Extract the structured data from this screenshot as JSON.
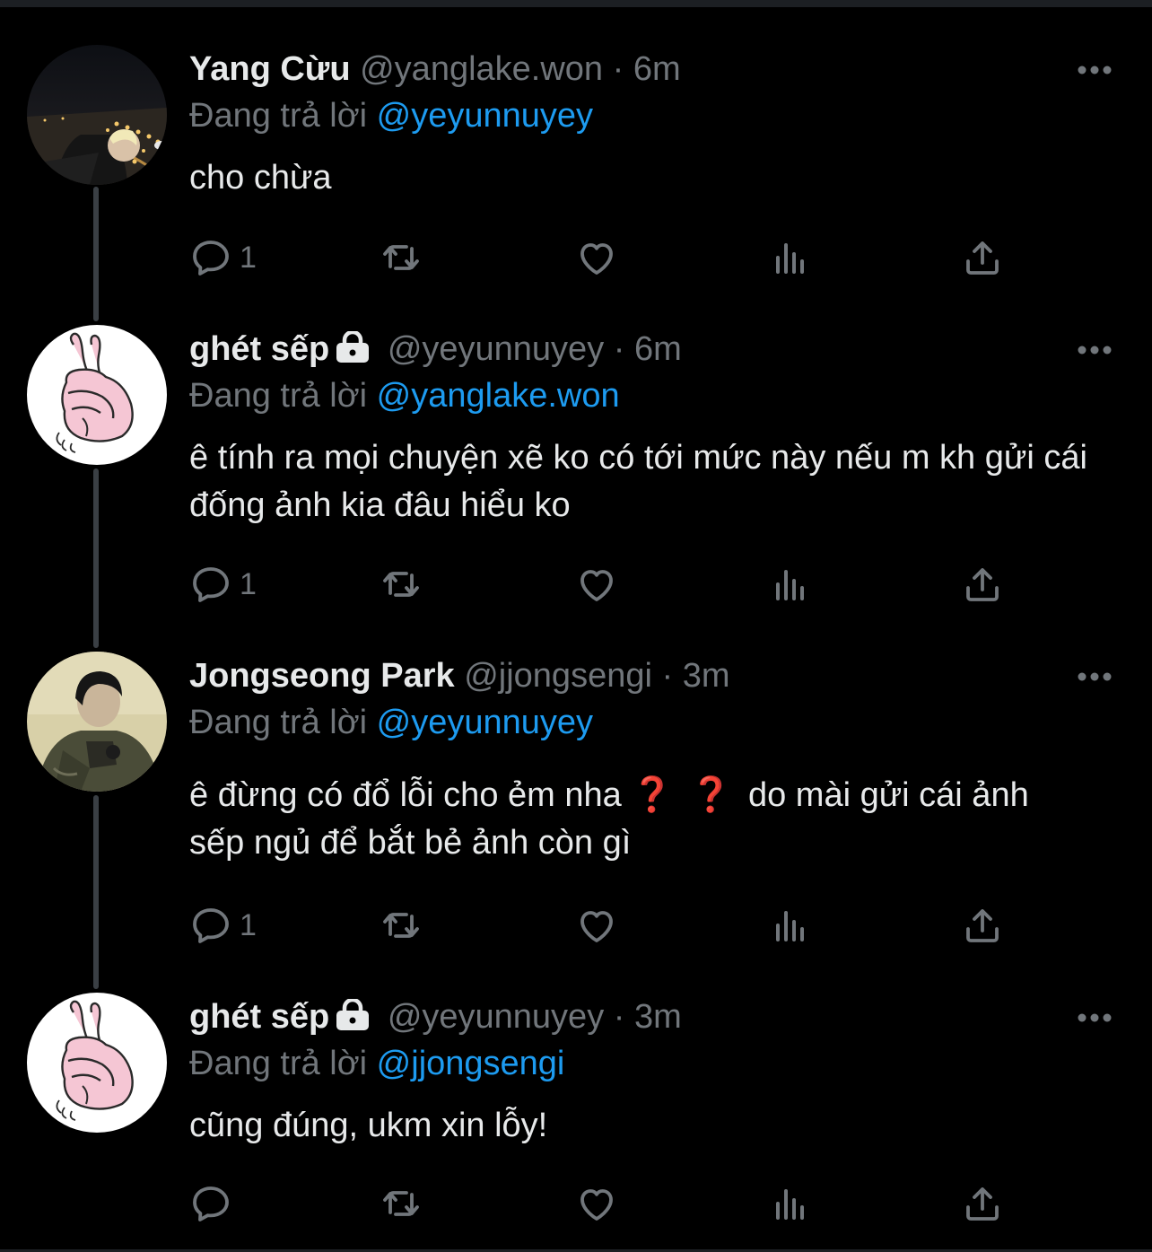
{
  "labels": {
    "replying_to": "Đang trả lời"
  },
  "tweets": [
    {
      "name": "Yang Cừu",
      "handle": "@yanglake.won",
      "separator": "·",
      "time": "6m",
      "locked": false,
      "replying_to": "@yeyunnuyey",
      "text": "cho chừa",
      "reply_count": "1",
      "avatar": "night-city-photo-avatar"
    },
    {
      "name": "ghét sếp",
      "handle": "@yeyunnuyey",
      "separator": "·",
      "time": "6m",
      "locked": true,
      "replying_to": "@yanglake.won",
      "text": "ê tính ra mọi chuyện xẽ ko có tới mức này nếu m kh gửi cái đống ảnh kia đâu hiểu ko",
      "reply_count": "1",
      "avatar": "pink-bunny-avatar"
    },
    {
      "name": "Jongseong Park",
      "handle": "@jjongsengi",
      "separator": "·",
      "time": "3m",
      "locked": false,
      "replying_to": "@yeyunnuyey",
      "text_before": "ê đừng có đổ lỗi cho ẻm nha",
      "emoji": [
        "❓",
        "❓"
      ],
      "text_after": "do mài gửi cái ảnh sếp ngủ để bắt bẻ ảnh còn gì",
      "reply_count": "1",
      "avatar": "person-photo-avatar"
    },
    {
      "name": "ghét sếp",
      "handle": "@yeyunnuyey",
      "separator": "·",
      "time": "3m",
      "locked": true,
      "replying_to": "@jjongsengi",
      "text": "cũng đúng, ukm xin lỗy!",
      "reply_count": "",
      "avatar": "pink-bunny-avatar"
    }
  ],
  "icons": {
    "reply": "reply-icon",
    "retweet": "retweet-icon",
    "like": "heart-icon",
    "views": "views-icon",
    "share": "share-icon",
    "more": "more-icon",
    "lock": "lock-icon"
  },
  "colors": {
    "background": "#000000",
    "text": "#e7e9ea",
    "muted": "#71767b",
    "accent": "#1d9bf0",
    "thread_line": "#3a3f44"
  }
}
